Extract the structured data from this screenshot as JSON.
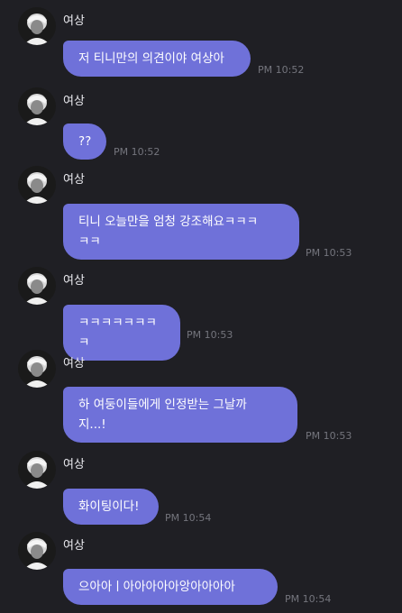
{
  "chat": {
    "messages": [
      {
        "sender": "여상",
        "text": "저 티니만의 의견이야 여상아",
        "time": "PM 10:52"
      },
      {
        "sender": "여상",
        "text": "??",
        "time": "PM 10:52"
      },
      {
        "sender": "여상",
        "text": "티니 오늘만을 엄청 강조해요ㅋㅋㅋ\nㅋㅋ",
        "time": "PM 10:53"
      },
      {
        "sender": "여상",
        "text": "ㅋㅋㅋㅋㅋㅋㅋㅋ",
        "time": "PM 10:53"
      },
      {
        "sender": "여상",
        "text": "하 여둥이들에게 인정받는 그날까\n지...!",
        "time": "PM 10:53"
      },
      {
        "sender": "여상",
        "text": "화이팅이다!",
        "time": "PM 10:54"
      },
      {
        "sender": "여상",
        "text": "으아아ㅣ아아아아아앙아아아아",
        "time": "PM 10:54"
      }
    ]
  },
  "colors": {
    "background": "#1f1f24",
    "bubble": "#6f71d9",
    "bubble_text": "#ffffff",
    "sender_text": "#e9e9ee",
    "time_text": "#74757d"
  }
}
